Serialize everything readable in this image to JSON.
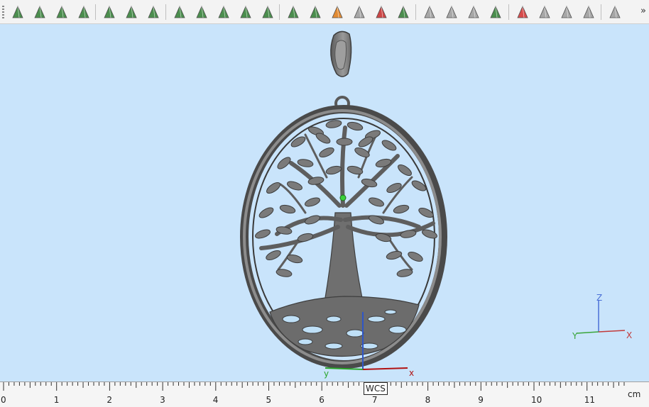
{
  "toolbar": {
    "tools": [
      {
        "name": "vertex-select-icon",
        "color": "#2e7d32"
      },
      {
        "name": "face-select-icon",
        "color": "#2e7d32"
      },
      {
        "name": "edge-select-icon",
        "color": "#2e7d32"
      },
      {
        "name": "circle-select-icon",
        "color": "#2e7d32"
      },
      {
        "name": "rectangle-tool-icon",
        "color": "#2e7d32"
      },
      {
        "name": "nodes-tool-icon",
        "color": "#2e7d32"
      },
      {
        "name": "curve-tool-icon",
        "color": "#2e7d32"
      },
      {
        "name": "mesh-grid-icon",
        "color": "#2e7d32"
      },
      {
        "name": "cluster-tool-icon",
        "color": "#2e7d32"
      },
      {
        "name": "star-pattern-icon",
        "color": "#2e7d32"
      },
      {
        "name": "radial-pattern-icon",
        "color": "#2e7d32"
      },
      {
        "name": "radial-split-icon",
        "color": "#2e7d32"
      },
      {
        "name": "box-view-icon",
        "color": "#2e7d32"
      },
      {
        "name": "box-front-icon",
        "color": "#2e7d32"
      },
      {
        "name": "box-colored-icon",
        "color": "#e07a12"
      },
      {
        "name": "box-wire-icon",
        "color": "#9a9a9a"
      },
      {
        "name": "box-marked-icon",
        "color": "#c62828"
      },
      {
        "name": "box-filled-icon",
        "color": "#2e7d32"
      },
      {
        "name": "cursor-gray-icon",
        "color": "#9a9a9a"
      },
      {
        "name": "cursor-flag-icon",
        "color": "#9a9a9a"
      },
      {
        "name": "cursor-arrow-icon",
        "color": "#9a9a9a"
      },
      {
        "name": "cursor-globe-icon",
        "color": "#2e7d32"
      },
      {
        "name": "delete-cross-icon",
        "color": "#d32f2f"
      },
      {
        "name": "hatch-triangle-icon",
        "color": "#9a9a9a"
      },
      {
        "name": "copy-triangle-icon",
        "color": "#9a9a9a"
      },
      {
        "name": "slash-triangle-icon",
        "color": "#9a9a9a"
      },
      {
        "name": "eye-triangle-icon",
        "color": "#9a9a9a"
      }
    ],
    "overflow_label": "»"
  },
  "viewport": {
    "axes_world": {
      "x": "x",
      "y": "y"
    },
    "axes_gizmo": {
      "z": "Z",
      "y": "Y",
      "x": "X"
    }
  },
  "ruler": {
    "ticks": [
      "0",
      "1",
      "2",
      "3",
      "4",
      "5",
      "6",
      "7",
      "8",
      "9",
      "10",
      "11"
    ],
    "unit": "cm",
    "wcs_label": "WCS"
  }
}
